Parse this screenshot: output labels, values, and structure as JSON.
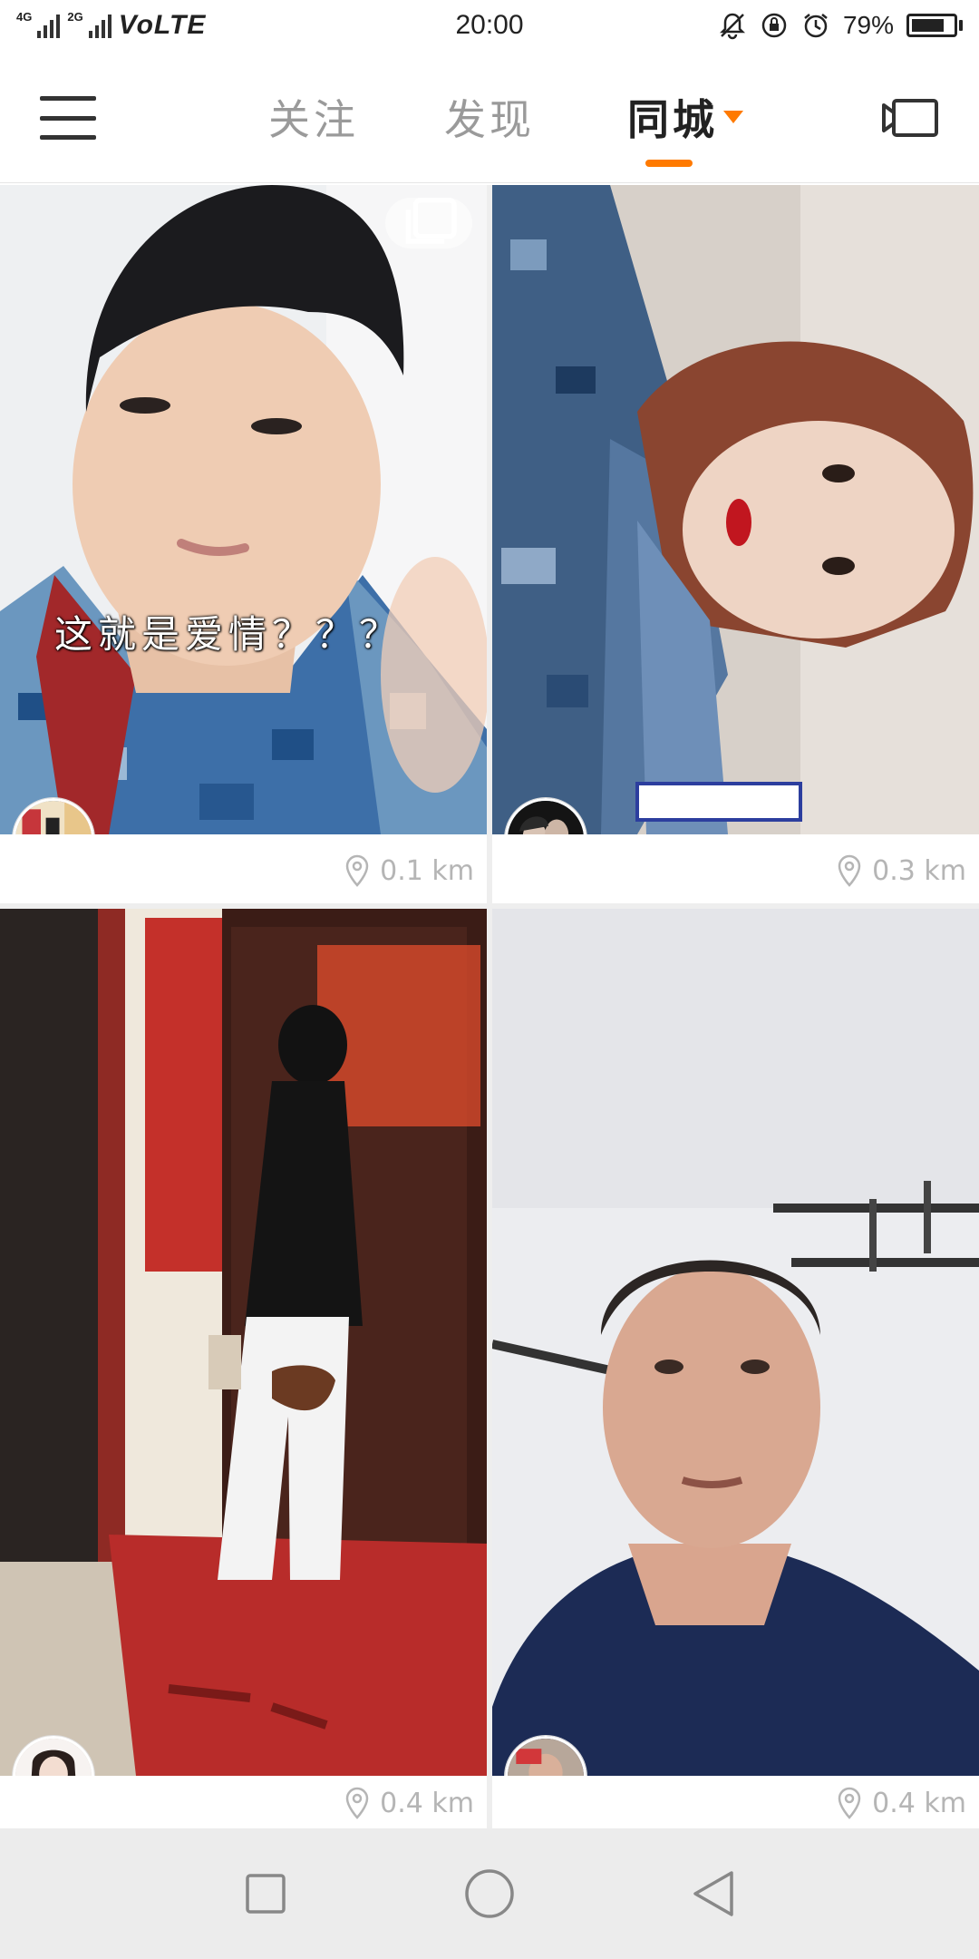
{
  "status_bar": {
    "network_tag_1": "4G",
    "network_tag_2": "2G",
    "volte": "VoLTE",
    "time": "20:00",
    "battery": "79%",
    "battery_level": 0.79,
    "icons": [
      "silent-icon",
      "rotation-lock-icon",
      "alarm-icon",
      "battery-icon"
    ]
  },
  "top_nav": {
    "tabs": [
      {
        "label": "关注",
        "active": false
      },
      {
        "label": "发现",
        "active": false
      },
      {
        "label": "同城",
        "active": true
      }
    ],
    "accent_color": "#ff7a00",
    "icons": [
      "menu-icon",
      "dropdown-arrow-icon",
      "camera-icon"
    ]
  },
  "feed": {
    "cards": [
      {
        "caption": "这就是爱情？？？",
        "distance": "0.1 km",
        "multi_image": true
      },
      {
        "caption": "",
        "distance": "0.3 km",
        "multi_image": false
      },
      {
        "caption": "",
        "distance": "0.4 km",
        "multi_image": false
      },
      {
        "caption": "",
        "distance": "0.4 km",
        "multi_image": false
      }
    ],
    "distance_icon": "location-pin-icon"
  },
  "system_nav": {
    "icons": [
      "recents-icon",
      "home-icon",
      "back-icon"
    ]
  }
}
